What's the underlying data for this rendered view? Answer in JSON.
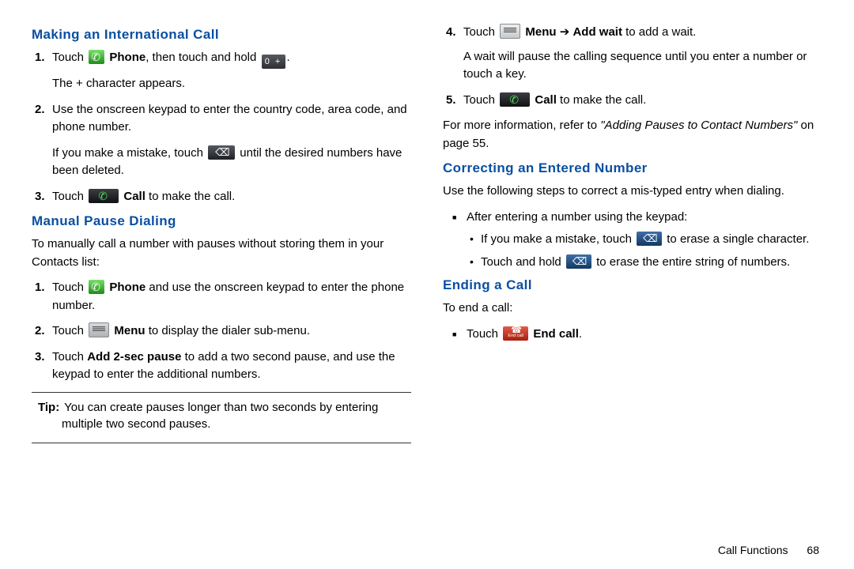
{
  "left": {
    "heading1": "Making an International Call",
    "steps1": {
      "s1_a": "Touch ",
      "s1_phone_bold": "Phone",
      "s1_b": ", then touch and hold ",
      "s1_c": ".",
      "s1_line2": "The + character appears.",
      "s2": "Use the onscreen keypad to enter the country code, area code, and phone number.",
      "s2_line2a": "If you make a mistake, touch ",
      "s2_line2b": " until the desired numbers have been deleted.",
      "s3_a": "Touch ",
      "s3_call_bold": "Call",
      "s3_b": " to make the call."
    },
    "heading2": "Manual Pause Dialing",
    "intro2": "To manually call a number with pauses without storing them in your Contacts list:",
    "steps2": {
      "s1_a": "Touch ",
      "s1_phone_bold": "Phone",
      "s1_b": " and use the onscreen keypad to enter the phone number.",
      "s2_a": "Touch ",
      "s2_menu_bold": "Menu",
      "s2_b": " to display the dialer sub-menu.",
      "s3_a": "Touch ",
      "s3_bold": "Add 2-sec pause",
      "s3_b": " to add a two second pause, and use the keypad to enter the additional numbers."
    },
    "tip_label": "Tip:",
    "tip_text": " You can create pauses longer than two seconds by entering multiple two second pauses."
  },
  "right": {
    "cont_steps": {
      "s4_a": "Touch ",
      "s4_menu_bold": "Menu",
      "s4_arrow": " ➔ ",
      "s4_addwait_bold": "Add wait",
      "s4_b": " to add a wait.",
      "s4_line2": "A wait will pause the calling sequence until you enter a number or touch a key.",
      "s5_a": "Touch ",
      "s5_call_bold": "Call",
      "s5_b": " to make the call."
    },
    "xref_a": "For more information, refer to ",
    "xref_italic": "\"Adding Pauses to Contact Numbers\"",
    "xref_b": " on page 55.",
    "heading3": "Correcting an Entered Number",
    "intro3": "Use the following steps to correct a mis-typed entry when dialing.",
    "square1": "After entering a number using the keypad:",
    "b1_a": "If you make a mistake, touch ",
    "b1_b": " to erase a single character.",
    "b2_a": "Touch and hold ",
    "b2_b": " to erase the entire string of numbers.",
    "heading4": "Ending a Call",
    "intro4": "To end a call:",
    "square2_a": "Touch ",
    "square2_bold": "End call",
    "square2_b": "."
  },
  "icons": {
    "zero_key_label": "0 +"
  },
  "footer": {
    "section": "Call Functions",
    "page": "68"
  }
}
